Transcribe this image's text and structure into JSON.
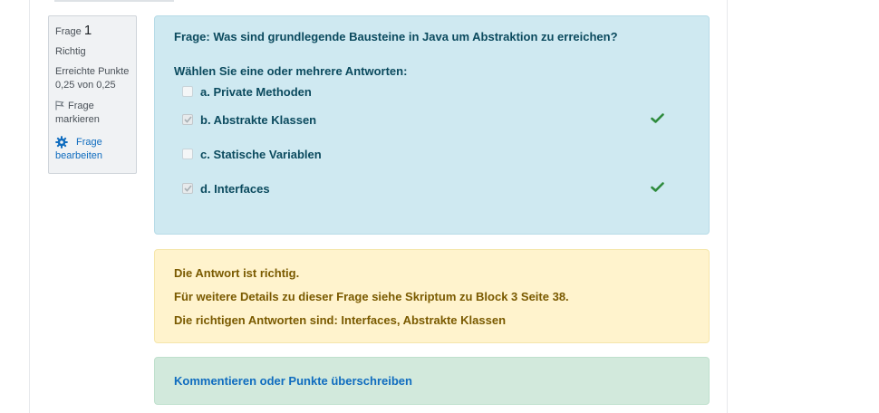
{
  "info": {
    "frage_label": "Frage",
    "frage_number": "1",
    "status": "Richtig",
    "points_label": "Erreichte Punkte",
    "points_value": "0,25 von 0,25",
    "flag_label_1": "Frage",
    "flag_label_2": "markieren",
    "edit_label_1": "Frage",
    "edit_label_2": "bearbeiten"
  },
  "question": {
    "text": "Frage: Was sind grundlegende Bausteine in Java um Abstraktion zu erreichen?",
    "prompt": "Wählen Sie eine oder mehrere Antworten:",
    "answers": [
      {
        "label": "a. Private Methoden",
        "checked": false,
        "correct": false
      },
      {
        "label": "b. Abstrakte Klassen",
        "checked": true,
        "correct": true
      },
      {
        "label": "c. Statische Variablen",
        "checked": false,
        "correct": false
      },
      {
        "label": "d. Interfaces",
        "checked": true,
        "correct": true
      }
    ]
  },
  "feedback": {
    "line1": "Die Antwort ist richtig.",
    "line2": "Für weitere Details zu dieser Frage siehe Skriptum zu Block 3 Seite 38.",
    "line3": "Die richtigen Antworten sind: Interfaces, Abstrakte Klassen"
  },
  "comment": {
    "link": "Kommentieren oder Punkte überschreiben"
  },
  "colors": {
    "question_bg": "#cfe9f1",
    "feedback_bg": "#fff3cd",
    "comment_bg": "#d2e9dc",
    "correct_tick": "#2e8b3d",
    "link": "#0f6cbf"
  }
}
